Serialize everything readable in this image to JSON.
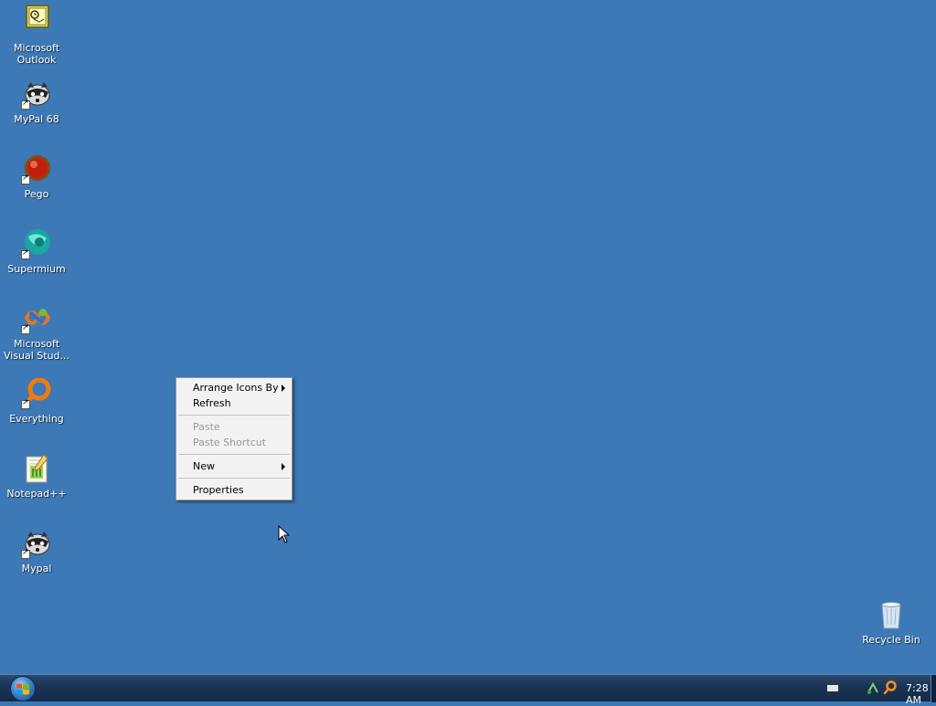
{
  "desktop": {
    "icons": [
      {
        "label": "Microsoft\nOutlook",
        "icon": "outlook-icon"
      },
      {
        "label": "MyPal 68",
        "icon": "mypal-icon"
      },
      {
        "label": "Pego",
        "icon": "pego-icon"
      },
      {
        "label": "Supermium",
        "icon": "supermium-icon"
      },
      {
        "label": "Microsoft\nVisual Stud...",
        "icon": "visual-studio-icon"
      },
      {
        "label": "Everything",
        "icon": "everything-icon"
      },
      {
        "label": "Notepad++",
        "icon": "notepad-plus-plus-icon"
      },
      {
        "label": "Mypal",
        "icon": "mypal-icon"
      },
      {
        "label": "Recycle Bin",
        "icon": "recycle-bin-icon"
      }
    ]
  },
  "context_menu": {
    "arrange_icons_by": "Arrange Icons By",
    "refresh": "Refresh",
    "paste": "Paste",
    "paste_shortcut": "Paste Shortcut",
    "new": "New",
    "properties": "Properties"
  },
  "taskbar": {
    "clock": "7:28 AM",
    "start_icon": "windows-orb-icon"
  },
  "colors": {
    "desktop_background": "#3d79b6",
    "menu_background": "#f2f2f2",
    "disabled_text": "#9a9a9a"
  }
}
